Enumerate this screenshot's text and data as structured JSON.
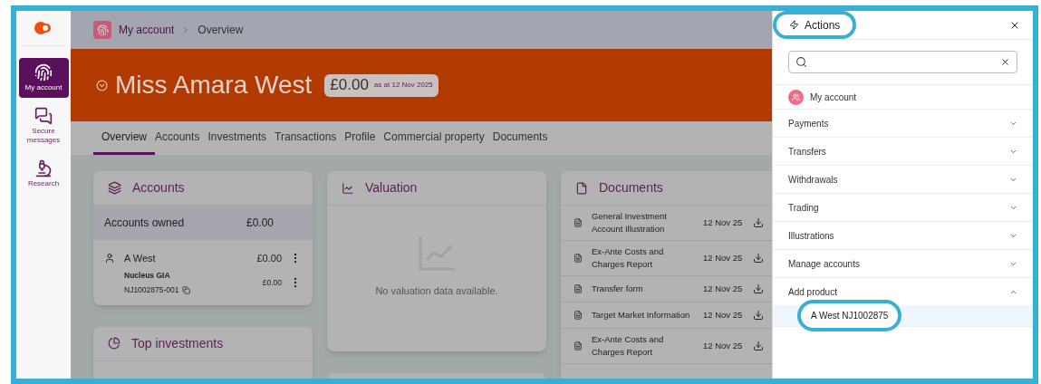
{
  "sidebar": {
    "items": [
      {
        "kind": "account",
        "label": "My account",
        "selected": true
      },
      {
        "kind": "messages",
        "label": "Secure messages",
        "selected": false
      },
      {
        "kind": "research",
        "label": "Research",
        "selected": false
      }
    ]
  },
  "breadcrumb": [
    "My account",
    "Overview"
  ],
  "customer": {
    "name": "Miss Amara West",
    "balance": "£0.00",
    "as_at": "as at 12 Nov 2025"
  },
  "tabs": [
    {
      "label": "Overview",
      "selected": true
    },
    {
      "label": "Accounts",
      "selected": false
    },
    {
      "label": "Investments",
      "selected": false
    },
    {
      "label": "Transactions",
      "selected": false
    },
    {
      "label": "Profile",
      "selected": false
    },
    {
      "label": "Commercial property",
      "selected": false
    },
    {
      "label": "Documents",
      "selected": false
    }
  ],
  "accounts_card": {
    "title": "Accounts",
    "summary": {
      "label": "Accounts owned",
      "value": "£0.00"
    },
    "holders": [
      {
        "name": "A West",
        "value": "£0.00",
        "accounts": [
          {
            "product": "Nucleus GIA",
            "number": "NJ1002875-001",
            "value": "£0.00"
          }
        ]
      }
    ]
  },
  "valuation_card": {
    "title": "Valuation",
    "empty_message": "No valuation data available."
  },
  "documents_card": {
    "title": "Documents",
    "rows": [
      {
        "name": "General Investment Account Illustration",
        "date": "12 Nov 25"
      },
      {
        "name": "Ex-Ante Costs and Charges Report",
        "date": "12 Nov 25"
      },
      {
        "name": "Transfer form",
        "date": "12 Nov 25"
      },
      {
        "name": "Target Market Information",
        "date": "12 Nov 25"
      },
      {
        "name": "Ex-Ante Costs and Charges Report",
        "date": "12 Nov 25"
      }
    ]
  },
  "top_investments_card": {
    "title": "Top investments"
  },
  "actions_panel": {
    "title": "Actions",
    "highlighted": true,
    "account_link": "My account",
    "sections": [
      {
        "label": "Payments",
        "expanded": false
      },
      {
        "label": "Transfers",
        "expanded": false
      },
      {
        "label": "Withdrawals",
        "expanded": false
      },
      {
        "label": "Trading",
        "expanded": false
      },
      {
        "label": "Illustrations",
        "expanded": false
      },
      {
        "label": "Manage accounts",
        "expanded": false
      },
      {
        "label": "Add product",
        "expanded": true,
        "children": [
          {
            "label": "A West NJ1002875",
            "selected": true,
            "highlighted": true
          }
        ]
      }
    ]
  }
}
